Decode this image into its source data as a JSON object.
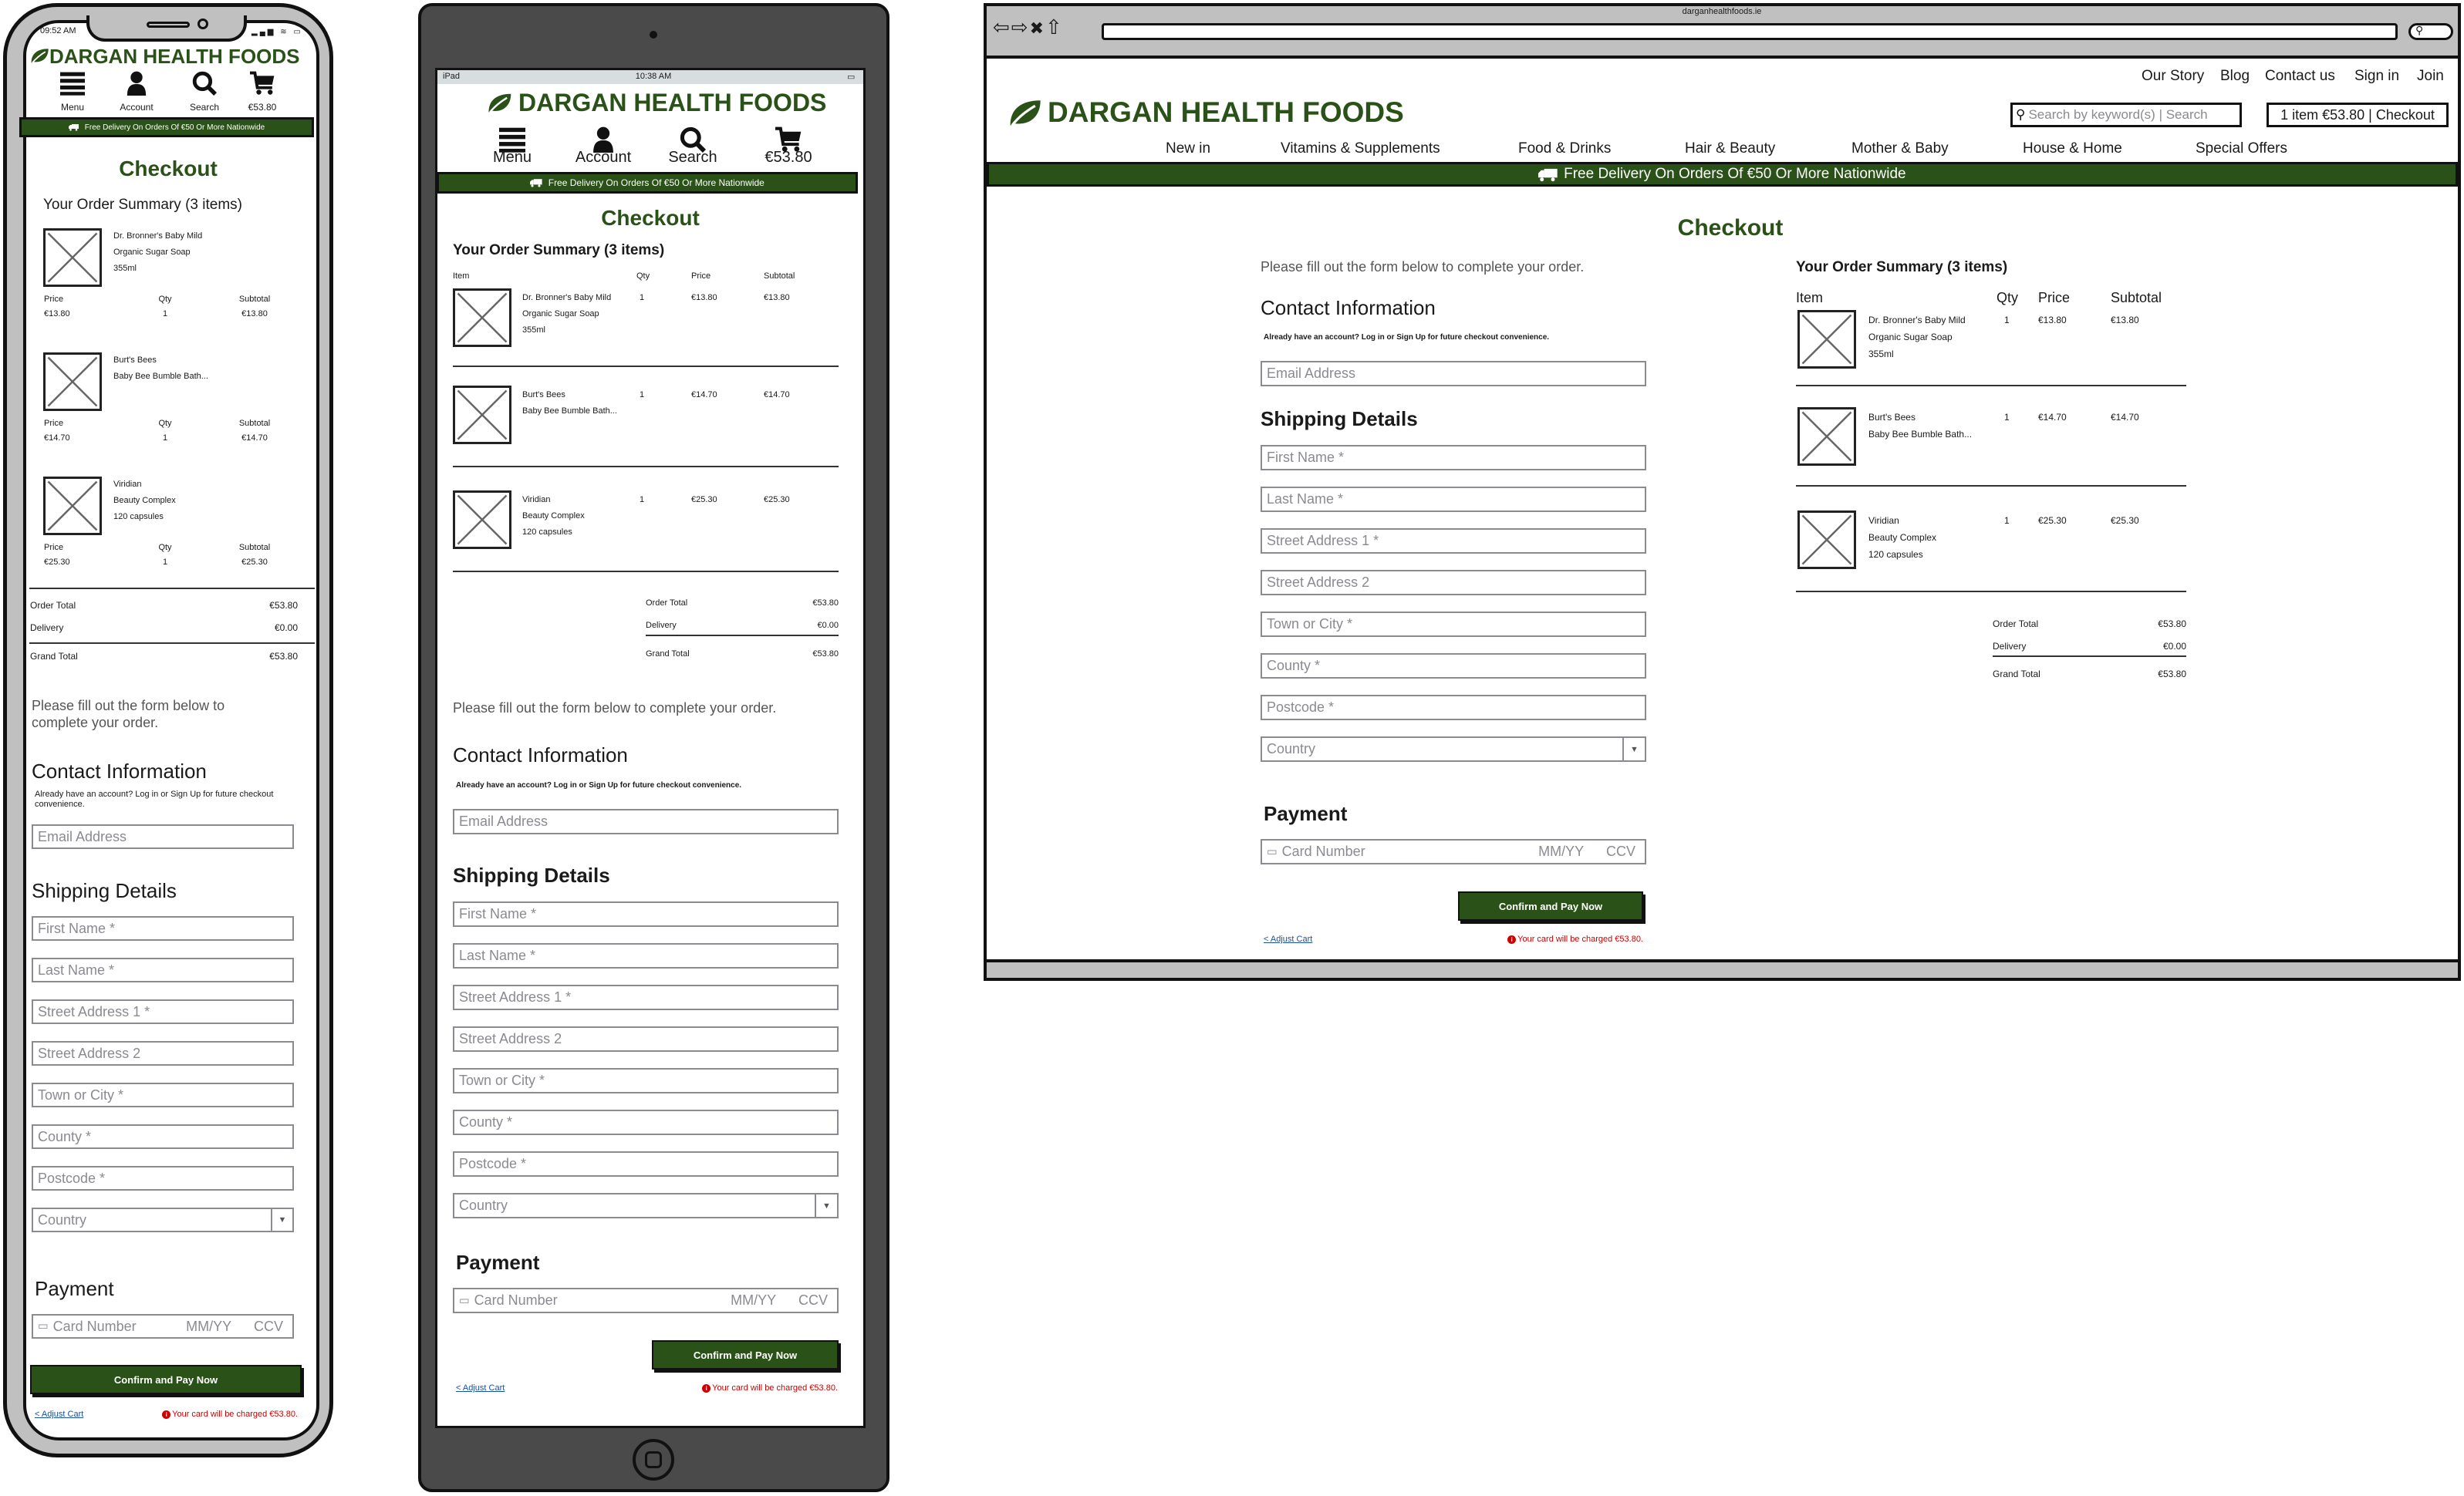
{
  "brand": "DARGAN HEALTH FOODS",
  "colors": {
    "brand": "#2a5218",
    "error": "#cc0000",
    "link": "#1a4fa0"
  },
  "delivery_banner": "Free Delivery On Orders Of €50 Or More Nationwide",
  "mobile_nav": [
    {
      "label": "Menu",
      "icon": "menu-icon"
    },
    {
      "label": "Account",
      "icon": "account-icon"
    },
    {
      "label": "Search",
      "icon": "search-icon"
    },
    {
      "label": "€53.80",
      "icon": "cart-icon"
    }
  ],
  "phone": {
    "status_time": "09:52 AM"
  },
  "tablet": {
    "device": "iPad",
    "status_time": "10:38 AM"
  },
  "browser": {
    "url": "darganhealthfoods.ie",
    "top_links": [
      "Our Story",
      "Blog",
      "Contact us",
      "Sign in",
      "Join"
    ],
    "search_placeholder": "Search by keyword(s) | Search",
    "cart": "1 item €53.80 | Checkout",
    "categories": [
      "New in",
      "Vitamins & Supplements",
      "Food & Drinks",
      "Hair & Beauty",
      "Mother & Baby",
      "House & Home",
      "Special Offers"
    ]
  },
  "checkout": {
    "title": "Checkout",
    "intro": "Please fill out the form below to complete your order.",
    "summary_title": "Your Order Summary (3 items)",
    "columns": {
      "item": "Item",
      "qty": "Qty",
      "price": "Price",
      "subtotal": "Subtotal"
    },
    "items": [
      {
        "name_lines": [
          "Dr. Bronner's Baby Mild",
          "Organic Sugar Soap",
          "355ml"
        ],
        "qty": "1",
        "price": "€13.80",
        "subtotal": "€13.80"
      },
      {
        "name_lines": [
          "Burt's Bees",
          "Baby Bee Bumble Bath..."
        ],
        "qty": "1",
        "price": "€14.70",
        "subtotal": "€14.70"
      },
      {
        "name_lines": [
          "Viridian",
          "Beauty Complex",
          "120 capsules"
        ],
        "qty": "1",
        "price": "€25.30",
        "subtotal": "€25.30"
      }
    ],
    "totals": [
      {
        "label": "Order Total",
        "value": "€53.80"
      },
      {
        "label": "Delivery",
        "value": "€0.00"
      },
      {
        "label": "Grand Total",
        "value": "€53.80"
      }
    ],
    "contact_title": "Contact Information",
    "account_note": "Already have an account? Log in or Sign Up for future checkout convenience.",
    "email_placeholder": "Email Address",
    "shipping_title": "Shipping Details",
    "shipping_fields": [
      "First Name *",
      "Last Name *",
      "Street Address 1 *",
      "Street Address 2",
      "Town or City *",
      "County *",
      "Postcode *",
      "Country"
    ],
    "payment_title": "Payment",
    "card": {
      "number": "Card Number",
      "expiry": "MM/YY",
      "ccv": "CCV"
    },
    "confirm": "Confirm and Pay Now",
    "adjust": "< Adjust Cart",
    "charge_note": "Your card will be charged €53.80."
  }
}
